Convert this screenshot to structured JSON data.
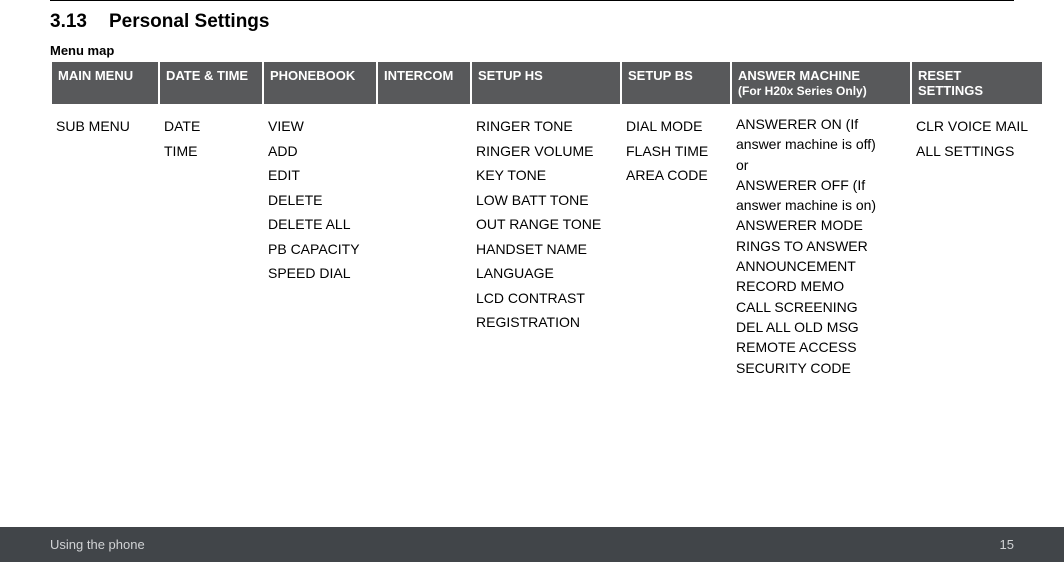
{
  "section_number": "3.13",
  "section_title": "Personal Settings",
  "menu_map_label": "Menu map",
  "headers": {
    "col0": "MAIN MENU",
    "col1": "DATE & TIME",
    "col2": "PHONEBOOK",
    "col3": "INTERCOM",
    "col4": "SETUP HS",
    "col5": "SETUP BS",
    "col6": "ANSWER MACHINE",
    "col6_sub": "(For H20x Series Only)",
    "col7a": "RESET",
    "col7b": "SETTINGS"
  },
  "cells": {
    "col0": "SUB MENU",
    "col1": "DATE\nTIME",
    "col2": "VIEW\nADD\nEDIT\nDELETE\nDELETE ALL\nPB CAPACITY\nSPEED DIAL",
    "col3": "",
    "col4": "RINGER TONE\nRINGER VOLUME\nKEY TONE\nLOW BATT TONE\nOUT RANGE TONE\nHANDSET NAME\nLANGUAGE\nLCD CONTRAST\nREGISTRATION",
    "col5": "DIAL MODE\nFLASH TIME\nAREA CODE",
    "col6": "ANSWERER ON (If answer machine is off)\nor\nANSWERER OFF (If answer machine is on)\nANSWERER MODE\nRINGS TO ANSWER\nANNOUNCEMENT\nRECORD MEMO\nCALL SCREENING\nDEL ALL OLD MSG\nREMOTE ACCESS\nSECURITY CODE",
    "col7": "CLR VOICE MAIL\nALL SETTINGS"
  },
  "footer": {
    "left": "Using the phone",
    "right": "15"
  }
}
